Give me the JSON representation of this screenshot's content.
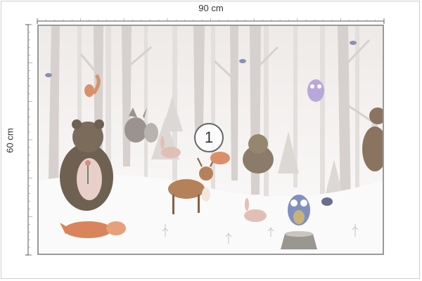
{
  "dimensions": {
    "width_label": "90 cm",
    "height_label": "60 cm"
  },
  "panel": {
    "number": "1"
  },
  "scene": {
    "description_icons": [
      "bear-icon",
      "fox-icon",
      "deer-icon",
      "owl-icon",
      "rabbit-icon",
      "squirrel-icon",
      "hedgehog-icon",
      "bird-icon",
      "tree-icon",
      "stump-icon"
    ]
  },
  "colors": {
    "frame": "#9a9a9a",
    "ruler": "#555555",
    "snow": "#f6f4f3",
    "trunk": "#d8d4d2",
    "fox": "#d9845a",
    "bear": "#6f6152",
    "deer": "#b5815a",
    "owl_blue": "#7f8fbf",
    "owl_pink": "#b8a8d8"
  }
}
